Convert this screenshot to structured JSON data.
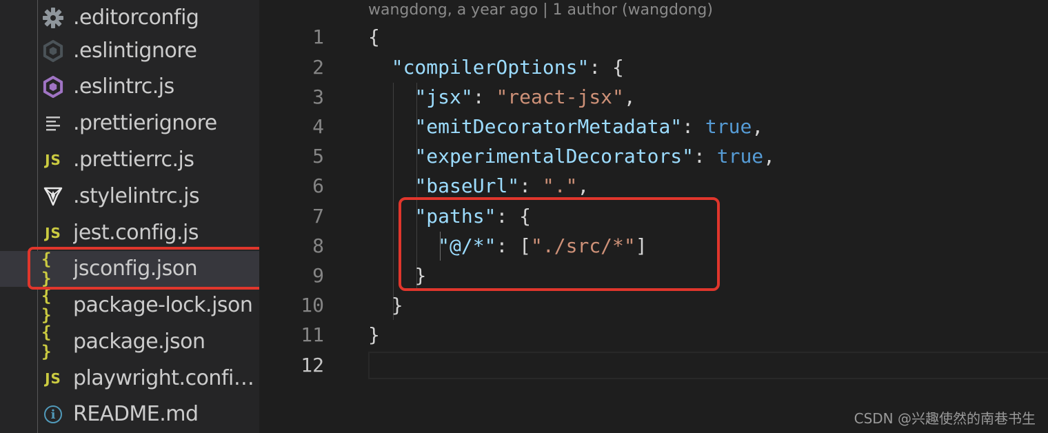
{
  "sidebar": {
    "items": [
      {
        "label": ".editorconfig",
        "icon": "gear-icon",
        "icon_text": "",
        "color": "#8f969c"
      },
      {
        "label": ".eslintignore",
        "icon": "eslint-gray-icon",
        "icon_text": "",
        "color": "#4b5358"
      },
      {
        "label": ".eslintrc.js",
        "icon": "eslint-purple-icon",
        "icon_text": "",
        "color": "#a074c4"
      },
      {
        "label": ".prettierignore",
        "icon": "lines-icon",
        "icon_text": "",
        "color": "#c5c5c5"
      },
      {
        "label": ".prettierrc.js",
        "icon": "js-icon",
        "icon_text": "JS",
        "color": "#cbcb41"
      },
      {
        "label": ".stylelintrc.js",
        "icon": "stylelint-icon",
        "icon_text": "",
        "color": "#e8e8e8"
      },
      {
        "label": "jest.config.js",
        "icon": "js-icon",
        "icon_text": "JS",
        "color": "#cbcb41"
      },
      {
        "label": "jsconfig.json",
        "icon": "json-braces-icon",
        "icon_text": "{ }",
        "color": "#cbcb41"
      },
      {
        "label": "package-lock.json",
        "icon": "json-braces-icon",
        "icon_text": "{ }",
        "color": "#cbcb41"
      },
      {
        "label": "package.json",
        "icon": "json-braces-icon",
        "icon_text": "{ }",
        "color": "#cbcb41"
      },
      {
        "label": "playwright.config...",
        "icon": "js-icon",
        "icon_text": "JS",
        "color": "#cbcb41"
      },
      {
        "label": "README.md",
        "icon": "info-icon",
        "icon_text": "i",
        "color": "#519aba"
      }
    ],
    "selected_index": 7
  },
  "editor": {
    "blame": "wangdong, a year ago | 1 author (wangdong)",
    "line_numbers": [
      "1",
      "2",
      "3",
      "4",
      "5",
      "6",
      "7",
      "8",
      "9",
      "10",
      "11",
      "12"
    ],
    "active_line": 12,
    "lines": [
      [
        {
          "t": "{",
          "c": "punc"
        }
      ],
      [
        {
          "t": "  ",
          "c": "punc"
        },
        {
          "t": "\"compilerOptions\"",
          "c": "key"
        },
        {
          "t": ": {",
          "c": "punc"
        }
      ],
      [
        {
          "t": "    ",
          "c": "punc"
        },
        {
          "t": "\"jsx\"",
          "c": "key"
        },
        {
          "t": ": ",
          "c": "punc"
        },
        {
          "t": "\"react-jsx\"",
          "c": "str"
        },
        {
          "t": ",",
          "c": "punc"
        }
      ],
      [
        {
          "t": "    ",
          "c": "punc"
        },
        {
          "t": "\"emitDecoratorMetadata\"",
          "c": "key"
        },
        {
          "t": ": ",
          "c": "punc"
        },
        {
          "t": "true",
          "c": "bool"
        },
        {
          "t": ",",
          "c": "punc"
        }
      ],
      [
        {
          "t": "    ",
          "c": "punc"
        },
        {
          "t": "\"experimentalDecorators\"",
          "c": "key"
        },
        {
          "t": ": ",
          "c": "punc"
        },
        {
          "t": "true",
          "c": "bool"
        },
        {
          "t": ",",
          "c": "punc"
        }
      ],
      [
        {
          "t": "    ",
          "c": "punc"
        },
        {
          "t": "\"baseUrl\"",
          "c": "key"
        },
        {
          "t": ": ",
          "c": "punc"
        },
        {
          "t": "\".\"",
          "c": "str"
        },
        {
          "t": ",",
          "c": "punc"
        }
      ],
      [
        {
          "t": "    ",
          "c": "punc"
        },
        {
          "t": "\"paths\"",
          "c": "key"
        },
        {
          "t": ": {",
          "c": "punc"
        }
      ],
      [
        {
          "t": "      ",
          "c": "punc"
        },
        {
          "t": "\"@/*\"",
          "c": "key"
        },
        {
          "t": ": [",
          "c": "punc"
        },
        {
          "t": "\"./src/*\"",
          "c": "str"
        },
        {
          "t": "]",
          "c": "punc"
        }
      ],
      [
        {
          "t": "    ",
          "c": "punc"
        },
        {
          "t": "}",
          "c": "punc"
        }
      ],
      [
        {
          "t": "  ",
          "c": "punc"
        },
        {
          "t": "}",
          "c": "punc"
        }
      ],
      [
        {
          "t": "}",
          "c": "punc"
        }
      ],
      []
    ]
  },
  "watermark": "CSDN @兴趣使然的南巷书生",
  "colors": {
    "highlight_red": "#e0362c",
    "key": "#9cdcfe",
    "string": "#ce9178",
    "boolean": "#569cd6"
  }
}
